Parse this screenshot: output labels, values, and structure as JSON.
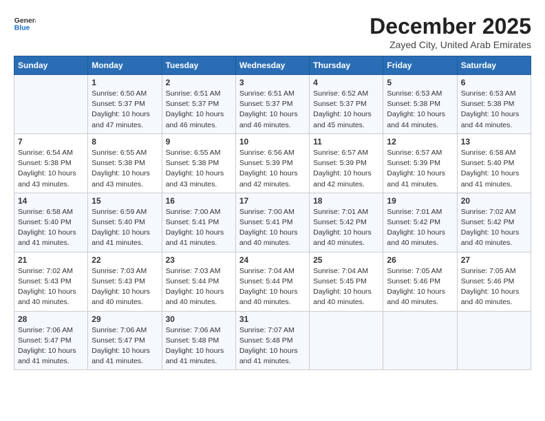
{
  "header": {
    "logo_general": "General",
    "logo_blue": "Blue",
    "month_title": "December 2025",
    "subtitle": "Zayed City, United Arab Emirates"
  },
  "calendar": {
    "days_of_week": [
      "Sunday",
      "Monday",
      "Tuesday",
      "Wednesday",
      "Thursday",
      "Friday",
      "Saturday"
    ],
    "weeks": [
      [
        {
          "day": "",
          "info": ""
        },
        {
          "day": "1",
          "info": "Sunrise: 6:50 AM\nSunset: 5:37 PM\nDaylight: 10 hours\nand 47 minutes."
        },
        {
          "day": "2",
          "info": "Sunrise: 6:51 AM\nSunset: 5:37 PM\nDaylight: 10 hours\nand 46 minutes."
        },
        {
          "day": "3",
          "info": "Sunrise: 6:51 AM\nSunset: 5:37 PM\nDaylight: 10 hours\nand 46 minutes."
        },
        {
          "day": "4",
          "info": "Sunrise: 6:52 AM\nSunset: 5:37 PM\nDaylight: 10 hours\nand 45 minutes."
        },
        {
          "day": "5",
          "info": "Sunrise: 6:53 AM\nSunset: 5:38 PM\nDaylight: 10 hours\nand 44 minutes."
        },
        {
          "day": "6",
          "info": "Sunrise: 6:53 AM\nSunset: 5:38 PM\nDaylight: 10 hours\nand 44 minutes."
        }
      ],
      [
        {
          "day": "7",
          "info": "Sunrise: 6:54 AM\nSunset: 5:38 PM\nDaylight: 10 hours\nand 43 minutes."
        },
        {
          "day": "8",
          "info": "Sunrise: 6:55 AM\nSunset: 5:38 PM\nDaylight: 10 hours\nand 43 minutes."
        },
        {
          "day": "9",
          "info": "Sunrise: 6:55 AM\nSunset: 5:38 PM\nDaylight: 10 hours\nand 43 minutes."
        },
        {
          "day": "10",
          "info": "Sunrise: 6:56 AM\nSunset: 5:39 PM\nDaylight: 10 hours\nand 42 minutes."
        },
        {
          "day": "11",
          "info": "Sunrise: 6:57 AM\nSunset: 5:39 PM\nDaylight: 10 hours\nand 42 minutes."
        },
        {
          "day": "12",
          "info": "Sunrise: 6:57 AM\nSunset: 5:39 PM\nDaylight: 10 hours\nand 41 minutes."
        },
        {
          "day": "13",
          "info": "Sunrise: 6:58 AM\nSunset: 5:40 PM\nDaylight: 10 hours\nand 41 minutes."
        }
      ],
      [
        {
          "day": "14",
          "info": "Sunrise: 6:58 AM\nSunset: 5:40 PM\nDaylight: 10 hours\nand 41 minutes."
        },
        {
          "day": "15",
          "info": "Sunrise: 6:59 AM\nSunset: 5:40 PM\nDaylight: 10 hours\nand 41 minutes."
        },
        {
          "day": "16",
          "info": "Sunrise: 7:00 AM\nSunset: 5:41 PM\nDaylight: 10 hours\nand 41 minutes."
        },
        {
          "day": "17",
          "info": "Sunrise: 7:00 AM\nSunset: 5:41 PM\nDaylight: 10 hours\nand 40 minutes."
        },
        {
          "day": "18",
          "info": "Sunrise: 7:01 AM\nSunset: 5:42 PM\nDaylight: 10 hours\nand 40 minutes."
        },
        {
          "day": "19",
          "info": "Sunrise: 7:01 AM\nSunset: 5:42 PM\nDaylight: 10 hours\nand 40 minutes."
        },
        {
          "day": "20",
          "info": "Sunrise: 7:02 AM\nSunset: 5:42 PM\nDaylight: 10 hours\nand 40 minutes."
        }
      ],
      [
        {
          "day": "21",
          "info": "Sunrise: 7:02 AM\nSunset: 5:43 PM\nDaylight: 10 hours\nand 40 minutes."
        },
        {
          "day": "22",
          "info": "Sunrise: 7:03 AM\nSunset: 5:43 PM\nDaylight: 10 hours\nand 40 minutes."
        },
        {
          "day": "23",
          "info": "Sunrise: 7:03 AM\nSunset: 5:44 PM\nDaylight: 10 hours\nand 40 minutes."
        },
        {
          "day": "24",
          "info": "Sunrise: 7:04 AM\nSunset: 5:44 PM\nDaylight: 10 hours\nand 40 minutes."
        },
        {
          "day": "25",
          "info": "Sunrise: 7:04 AM\nSunset: 5:45 PM\nDaylight: 10 hours\nand 40 minutes."
        },
        {
          "day": "26",
          "info": "Sunrise: 7:05 AM\nSunset: 5:46 PM\nDaylight: 10 hours\nand 40 minutes."
        },
        {
          "day": "27",
          "info": "Sunrise: 7:05 AM\nSunset: 5:46 PM\nDaylight: 10 hours\nand 40 minutes."
        }
      ],
      [
        {
          "day": "28",
          "info": "Sunrise: 7:06 AM\nSunset: 5:47 PM\nDaylight: 10 hours\nand 41 minutes."
        },
        {
          "day": "29",
          "info": "Sunrise: 7:06 AM\nSunset: 5:47 PM\nDaylight: 10 hours\nand 41 minutes."
        },
        {
          "day": "30",
          "info": "Sunrise: 7:06 AM\nSunset: 5:48 PM\nDaylight: 10 hours\nand 41 minutes."
        },
        {
          "day": "31",
          "info": "Sunrise: 7:07 AM\nSunset: 5:48 PM\nDaylight: 10 hours\nand 41 minutes."
        },
        {
          "day": "",
          "info": ""
        },
        {
          "day": "",
          "info": ""
        },
        {
          "day": "",
          "info": ""
        }
      ]
    ]
  }
}
